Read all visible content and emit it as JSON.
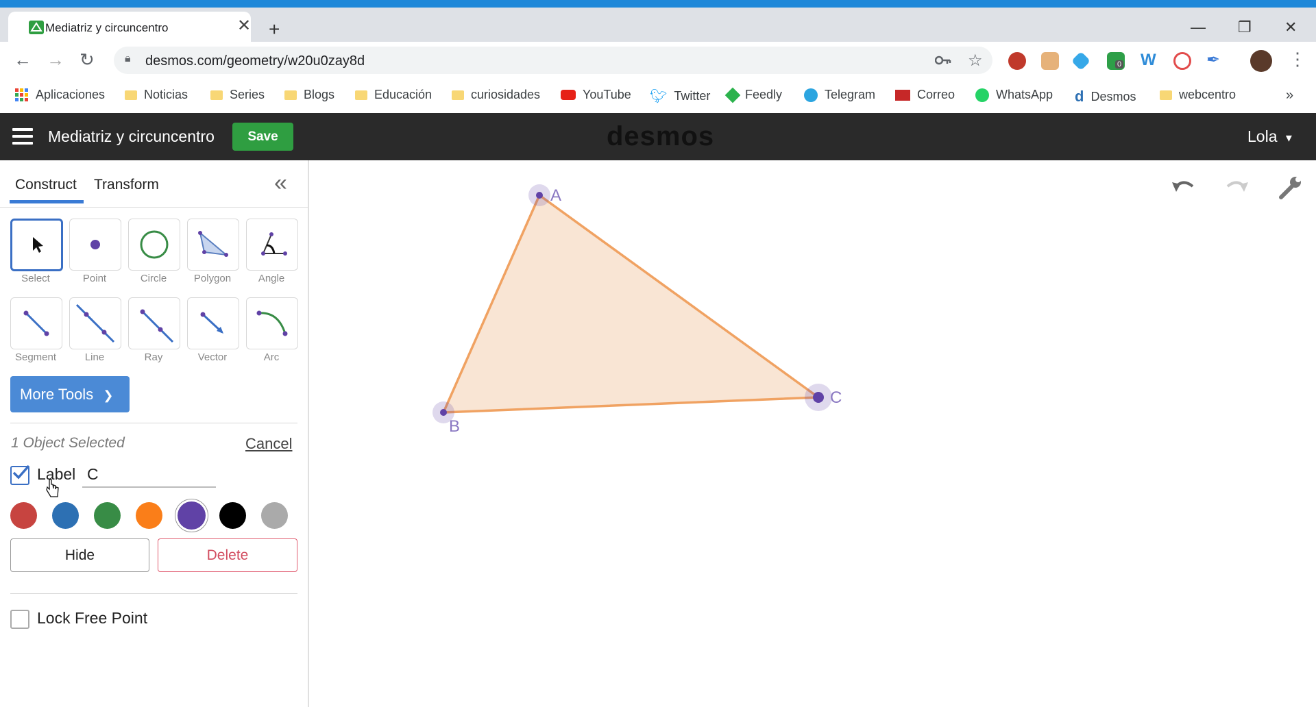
{
  "browser": {
    "tab_title": "Mediatriz y circuncentro",
    "url": "desmos.com/geometry/w20u0zay8d",
    "extension_badge": "0",
    "bookmarks": [
      {
        "label": "Aplicaciones",
        "icon": "apps-grid-icon"
      },
      {
        "label": "Noticias",
        "icon": "folder-icon"
      },
      {
        "label": "Series",
        "icon": "folder-icon"
      },
      {
        "label": "Blogs",
        "icon": "folder-icon"
      },
      {
        "label": "Educación",
        "icon": "folder-icon"
      },
      {
        "label": "curiosidades",
        "icon": "folder-icon"
      },
      {
        "label": "YouTube",
        "icon": "youtube-icon"
      },
      {
        "label": "Twitter",
        "icon": "twitter-icon"
      },
      {
        "label": "Feedly",
        "icon": "feedly-icon"
      },
      {
        "label": "Telegram",
        "icon": "telegram-icon"
      },
      {
        "label": "Correo",
        "icon": "mail-icon"
      },
      {
        "label": "WhatsApp",
        "icon": "whatsapp-icon"
      },
      {
        "label": "Desmos",
        "icon": "desmos-icon"
      },
      {
        "label": "webcentro",
        "icon": "folder-icon"
      }
    ],
    "more_bookmarks": "»"
  },
  "app": {
    "title": "Mediatriz y circuncentro",
    "save_label": "Save",
    "logo": "desmos",
    "user": "Lola",
    "user_caret": "▾"
  },
  "panel": {
    "tabs": [
      "Construct",
      "Transform"
    ],
    "collapse_glyph": "«",
    "tools_row1": [
      "Select",
      "Point",
      "Circle",
      "Polygon",
      "Angle"
    ],
    "tools_row2": [
      "Segment",
      "Line",
      "Ray",
      "Vector",
      "Arc"
    ],
    "more_tools": "More Tools",
    "selection_info": "1 Object Selected",
    "cancel": "Cancel",
    "label_checkbox": "Label",
    "label_checked": true,
    "label_value": "C",
    "colors": [
      "#c74440",
      "#2d70b3",
      "#388c46",
      "#fa7e19",
      "#6042a6",
      "#000000",
      "#aaaaaa"
    ],
    "selected_color": "#6042a6",
    "hide": "Hide",
    "delete": "Delete",
    "lock_free_point": "Lock Free Point",
    "lock_checked": false
  },
  "canvas": {
    "fill_color": "#f7dcc6",
    "stroke_color": "#f0a262",
    "point_color": "#6042a6",
    "points": [
      {
        "label": "A"
      },
      {
        "label": "B"
      },
      {
        "label": "C"
      }
    ]
  }
}
